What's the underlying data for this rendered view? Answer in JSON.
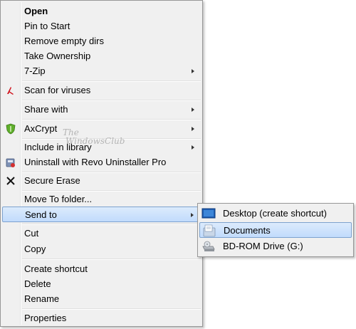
{
  "context_menu": {
    "items": [
      {
        "label": "Open",
        "underline": "O"
      },
      {
        "label": "Pin to Start"
      },
      {
        "label": "Remove empty dirs"
      },
      {
        "label": "Take Ownership"
      },
      {
        "label": "7-Zip"
      },
      {
        "label": "Scan for viruses"
      },
      {
        "label": "Share with"
      },
      {
        "label": "AxCrypt"
      },
      {
        "label": "Include in library"
      },
      {
        "label": "Uninstall with Revo Uninstaller Pro"
      },
      {
        "label": "Secure Erase"
      },
      {
        "label": "Move To folder..."
      },
      {
        "label": "Send to"
      },
      {
        "label": "Cut"
      },
      {
        "label": "Copy"
      },
      {
        "label": "Create shortcut"
      },
      {
        "label": "Delete"
      },
      {
        "label": "Rename"
      },
      {
        "label": "Properties"
      }
    ]
  },
  "send_to_submenu": {
    "items": [
      {
        "label": "Desktop (create shortcut)"
      },
      {
        "label": "Documents"
      },
      {
        "label": "BD-ROM Drive (G:)"
      }
    ]
  },
  "watermark": {
    "line1": "The",
    "line2": "WindowsClub"
  },
  "colors": {
    "menu_bg": "#f0f0f0",
    "highlight_border": "#7da2ce",
    "highlight_fill": "#c9dff9"
  }
}
